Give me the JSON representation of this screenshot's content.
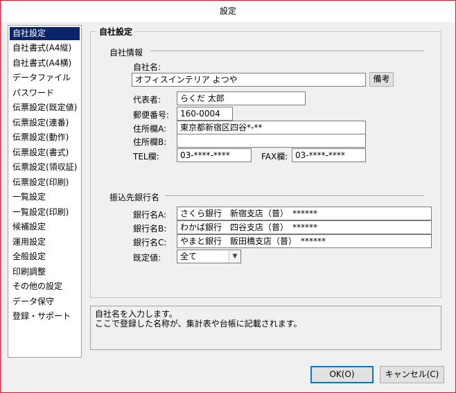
{
  "window": {
    "title": "設定"
  },
  "nav": {
    "items": [
      "自社設定",
      "自社書式(A4縦)",
      "自社書式(A4横)",
      "データファイル",
      "パスワード",
      "伝票設定(既定値)",
      "伝票設定(連番)",
      "伝票設定(動作)",
      "伝票設定(書式)",
      "伝票設定(領収証)",
      "伝票設定(印刷)",
      "一覧設定",
      "一覧設定(印刷)",
      "候補設定",
      "運用設定",
      "全般設定",
      "印刷調整",
      "その他の設定",
      "データ保守",
      "登録・サポート"
    ],
    "selected_index": 0
  },
  "panel": {
    "title": "自社設定",
    "company_info": {
      "heading": "自社情報",
      "name_label": "自社名:",
      "name_value": "オフィスインテリア よつや",
      "memo_button": "備考",
      "rep_label": "代表者:",
      "rep_value": "らくだ 太郎",
      "zip_label": "郵便番号:",
      "zip_value": "160-0004",
      "addr_a_label": "住所欄A:",
      "addr_a_value": "東京都新宿区四谷*-**",
      "addr_b_label": "住所欄B:",
      "addr_b_value": "",
      "tel_label": "TEL欄:",
      "tel_value": "03-****-****",
      "fax_label": "FAX欄:",
      "fax_value": "03-****-****"
    },
    "bank": {
      "heading": "振込先銀行名",
      "a_label": "銀行名A:",
      "a_value": "さくら銀行　新宿支店（普）　******",
      "b_label": "銀行名B:",
      "b_value": "わかば銀行　四谷支店（普）　******",
      "c_label": "銀行名C:",
      "c_value": "やまと銀行　飯田橋支店（普）　******",
      "default_label": "既定値:",
      "default_value": "全て"
    }
  },
  "help": {
    "line1": "自社名を入力します。",
    "line2": "ここで登録した名称が、集計表や台帳に記載されます。"
  },
  "buttons": {
    "ok": "OK(O)",
    "cancel": "キャンセル(C)"
  }
}
